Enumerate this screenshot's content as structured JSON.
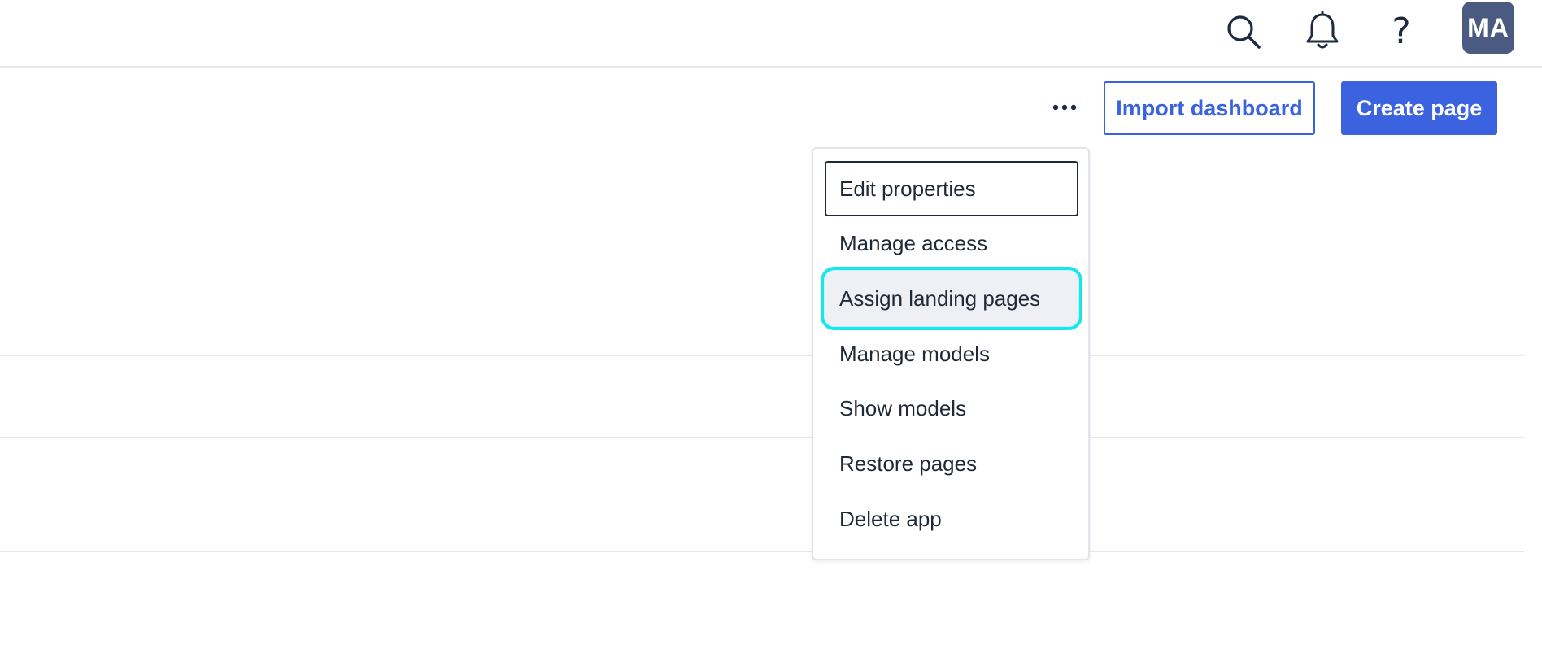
{
  "header": {
    "icons": [
      "search-icon",
      "bell-icon",
      "help-icon"
    ],
    "help_glyph": "?",
    "avatar_initials": "MA"
  },
  "toolbar": {
    "more_icon": "ellipsis-icon",
    "import_label": "Import dashboard",
    "create_label": "Create page"
  },
  "menu": {
    "items": [
      {
        "label": "Edit properties",
        "state": "focused"
      },
      {
        "label": "Manage access",
        "state": "normal"
      },
      {
        "label": "Assign landing pages",
        "state": "hovered"
      },
      {
        "label": "Manage models",
        "state": "normal"
      },
      {
        "label": "Show models",
        "state": "normal"
      },
      {
        "label": "Restore pages",
        "state": "normal"
      },
      {
        "label": "Delete app",
        "state": "normal"
      }
    ]
  },
  "colors": {
    "accent": "#3b63e0",
    "avatar_bg": "#4a5a80",
    "highlight": "#18e6ec",
    "text": "#1f2937",
    "divider": "#e6e8ee"
  }
}
